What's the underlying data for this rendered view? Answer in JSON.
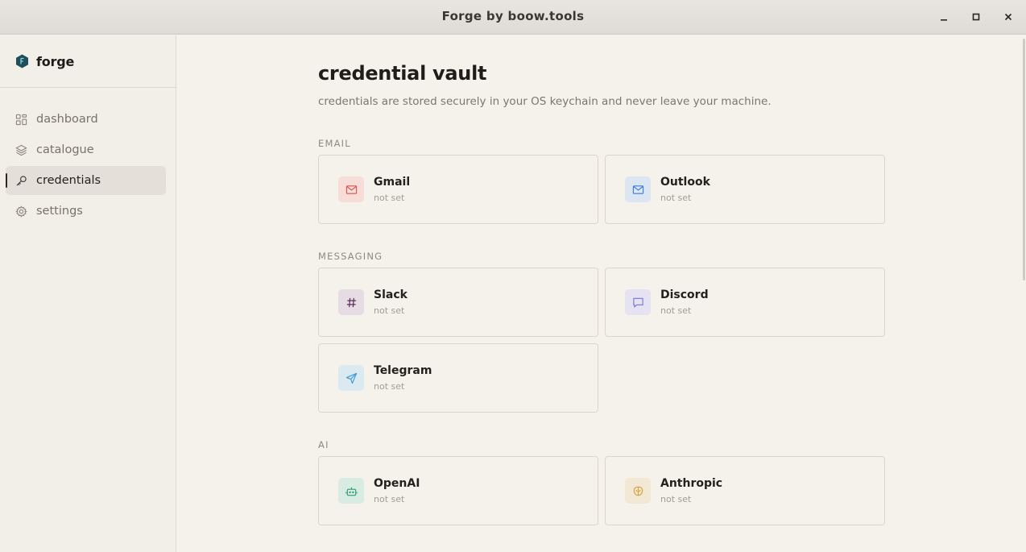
{
  "window": {
    "title": "Forge by boow.tools"
  },
  "sidebar": {
    "brand": "forge",
    "items": [
      {
        "label": "dashboard",
        "icon": "grid-icon"
      },
      {
        "label": "catalogue",
        "icon": "layers-icon"
      },
      {
        "label": "credentials",
        "icon": "key-icon",
        "active": true
      },
      {
        "label": "settings",
        "icon": "gear-icon"
      }
    ]
  },
  "main": {
    "title": "credential vault",
    "subtitle": "credentials are stored securely in your OS keychain and never leave your machine.",
    "sections": [
      {
        "label": "EMAIL",
        "items": [
          {
            "name": "Gmail",
            "status": "not set",
            "icon": "mail-icon",
            "color": "#d9534f"
          },
          {
            "name": "Outlook",
            "status": "not set",
            "icon": "mail-icon",
            "color": "#3b7bd4"
          }
        ]
      },
      {
        "label": "MESSAGING",
        "items": [
          {
            "name": "Slack",
            "status": "not set",
            "icon": "hash-icon",
            "color": "#5a2e5c"
          },
          {
            "name": "Discord",
            "status": "not set",
            "icon": "chat-bubble-icon",
            "color": "#7b73d6"
          },
          {
            "name": "Telegram",
            "status": "not set",
            "icon": "send-icon",
            "color": "#3a9bd6"
          }
        ]
      },
      {
        "label": "AI",
        "items": [
          {
            "name": "OpenAI",
            "status": "not set",
            "icon": "robot-icon",
            "color": "#2f9e72"
          },
          {
            "name": "Anthropic",
            "status": "not set",
            "icon": "brain-icon",
            "color": "#d4a23a"
          }
        ]
      }
    ]
  }
}
